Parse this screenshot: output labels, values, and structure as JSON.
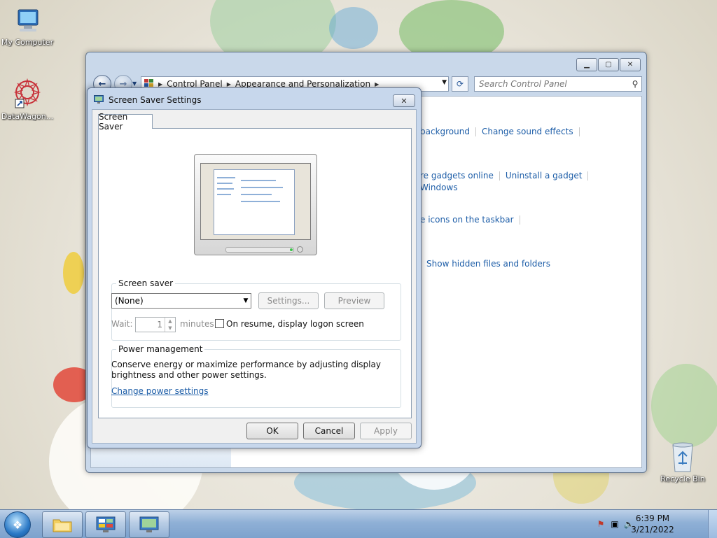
{
  "desktop": {
    "icons": [
      {
        "label": "My Computer",
        "icon": "computer-icon"
      },
      {
        "label": "DataWagon...",
        "icon": "datawagon-shortcut-icon"
      },
      {
        "label": "Recycle Bin",
        "icon": "recycle-bin-icon"
      }
    ]
  },
  "control_panel": {
    "breadcrumbs": [
      "Control Panel",
      "Appearance and Personalization"
    ],
    "search_placeholder": "Search Control Panel",
    "links": {
      "background": "background",
      "sound_effects": "Change sound effects",
      "gadgets_online": "re gadgets online",
      "uninstall_gadget": "Uninstall a gadget",
      "windows": "Windows",
      "taskbar_icons": "e icons on the taskbar",
      "hidden_files": "Show hidden files and folders"
    }
  },
  "dialog": {
    "title": "Screen Saver Settings",
    "tab": "Screen Saver",
    "screen_saver_group": "Screen saver",
    "selected_saver": "(None)",
    "settings_button": "Settings...",
    "preview_button": "Preview",
    "wait_label": "Wait:",
    "wait_value": "1",
    "minutes_label": "minutes",
    "resume_label": "On resume, display logon screen",
    "power_group": "Power management",
    "power_text_1": "Conserve energy or maximize performance by adjusting display",
    "power_text_2": "brightness and other power settings.",
    "power_link": "Change power settings",
    "ok": "OK",
    "cancel": "Cancel",
    "apply": "Apply"
  },
  "taskbar": {
    "time": "6:39 PM",
    "date": "3/21/2022"
  },
  "colors": {
    "link": "#1e5ea8",
    "taskbar": "#8fb0d6",
    "dialog_frame": "#c7d7ec"
  }
}
